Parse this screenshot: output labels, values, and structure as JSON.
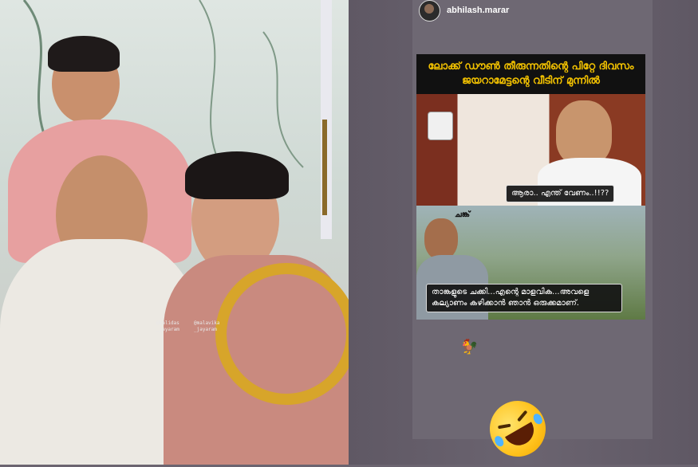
{
  "story": {
    "username": "abhilash.marar",
    "meme": {
      "title_line1": "ലോക്ക് ഡൗൺ തീരുന്നതിന്റെ പിറ്റേ ദിവസം",
      "title_line2": "ജയറാമേട്ടന്റെ വീടിന് മുന്നിൽ",
      "caption1": "ആരാ.. എന്ത് വേണം..!!??",
      "tag_label": "ചങ്ക്",
      "caption2": "താങ്കളുടെ ചക്കി...എന്റെ മാളവിക...അവളെ കല്യാണം കഴിക്കാൻ ഞാൻ ഒരുക്കമാണ്."
    },
    "mentions": [
      {
        "line1": "@kalidas",
        "line2": "_jayaram"
      },
      {
        "line1": "@malavika",
        "line2": "_jayaram"
      }
    ],
    "stickers": {
      "rooster": "🐓",
      "emoji_name": "rolling-on-the-floor-laughing-emoji"
    }
  },
  "colors": {
    "story_bg": "#6e6873",
    "meme_title_text": "#f3c200",
    "meme_title_bg": "#111111"
  }
}
